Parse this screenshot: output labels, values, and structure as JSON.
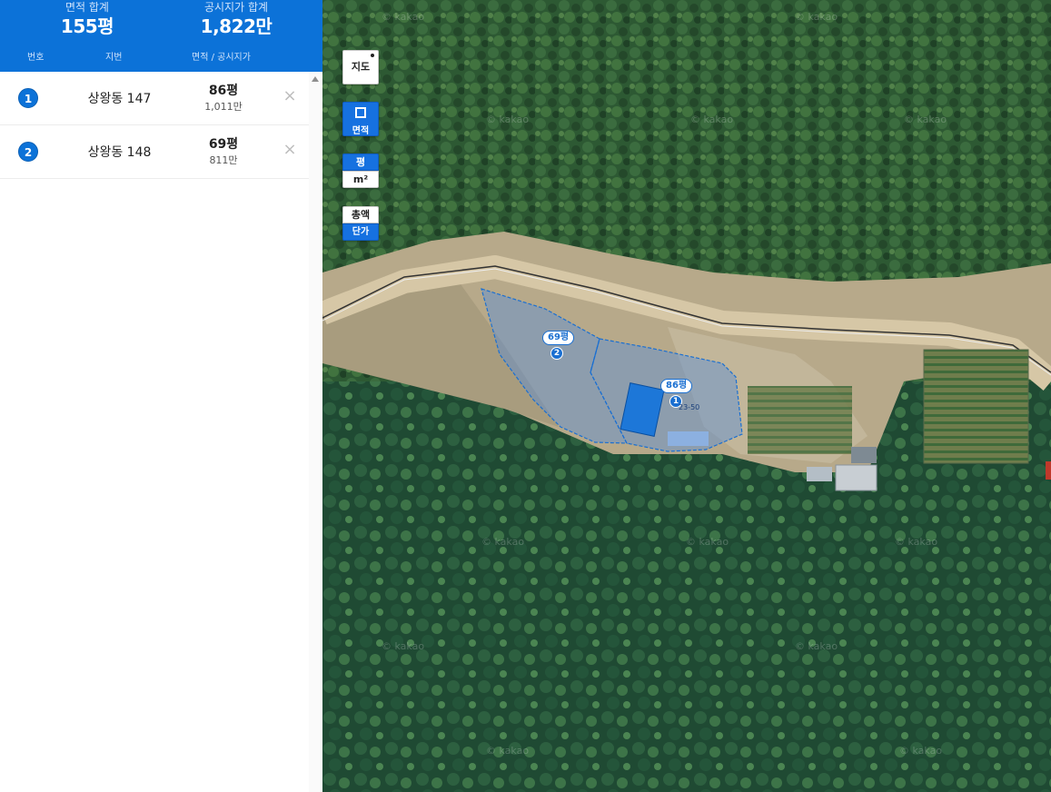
{
  "summary": {
    "area_label": "면적 합계",
    "area_value": "155평",
    "price_label": "공시지가 합계",
    "price_value": "1,822만"
  },
  "columns": {
    "number": "번호",
    "jibun": "지번",
    "area_price": "면적 / 공시지가"
  },
  "parcels": [
    {
      "number": "1",
      "jibun": "상왕동 147",
      "area": "86평",
      "price": "1,011만"
    },
    {
      "number": "2",
      "jibun": "상왕동 148",
      "area": "69평",
      "price": "811만"
    }
  ],
  "remove_glyph": "×",
  "map_controls": {
    "map_type": "지도",
    "area_tool": "면적",
    "unit_pyeong": "평",
    "unit_m2": "m²",
    "total": "총액",
    "unit_price": "단가"
  },
  "map_labels": {
    "parcel1_area": "86평",
    "parcel1_badge": "1",
    "parcel1_id": "23-50",
    "parcel2_area": "69평",
    "parcel2_badge": "2"
  },
  "watermark": "© kakao",
  "colors": {
    "accent": "#0c72d8",
    "parcel_fill": "#5b8fd8",
    "forest": "#2f5a35"
  }
}
